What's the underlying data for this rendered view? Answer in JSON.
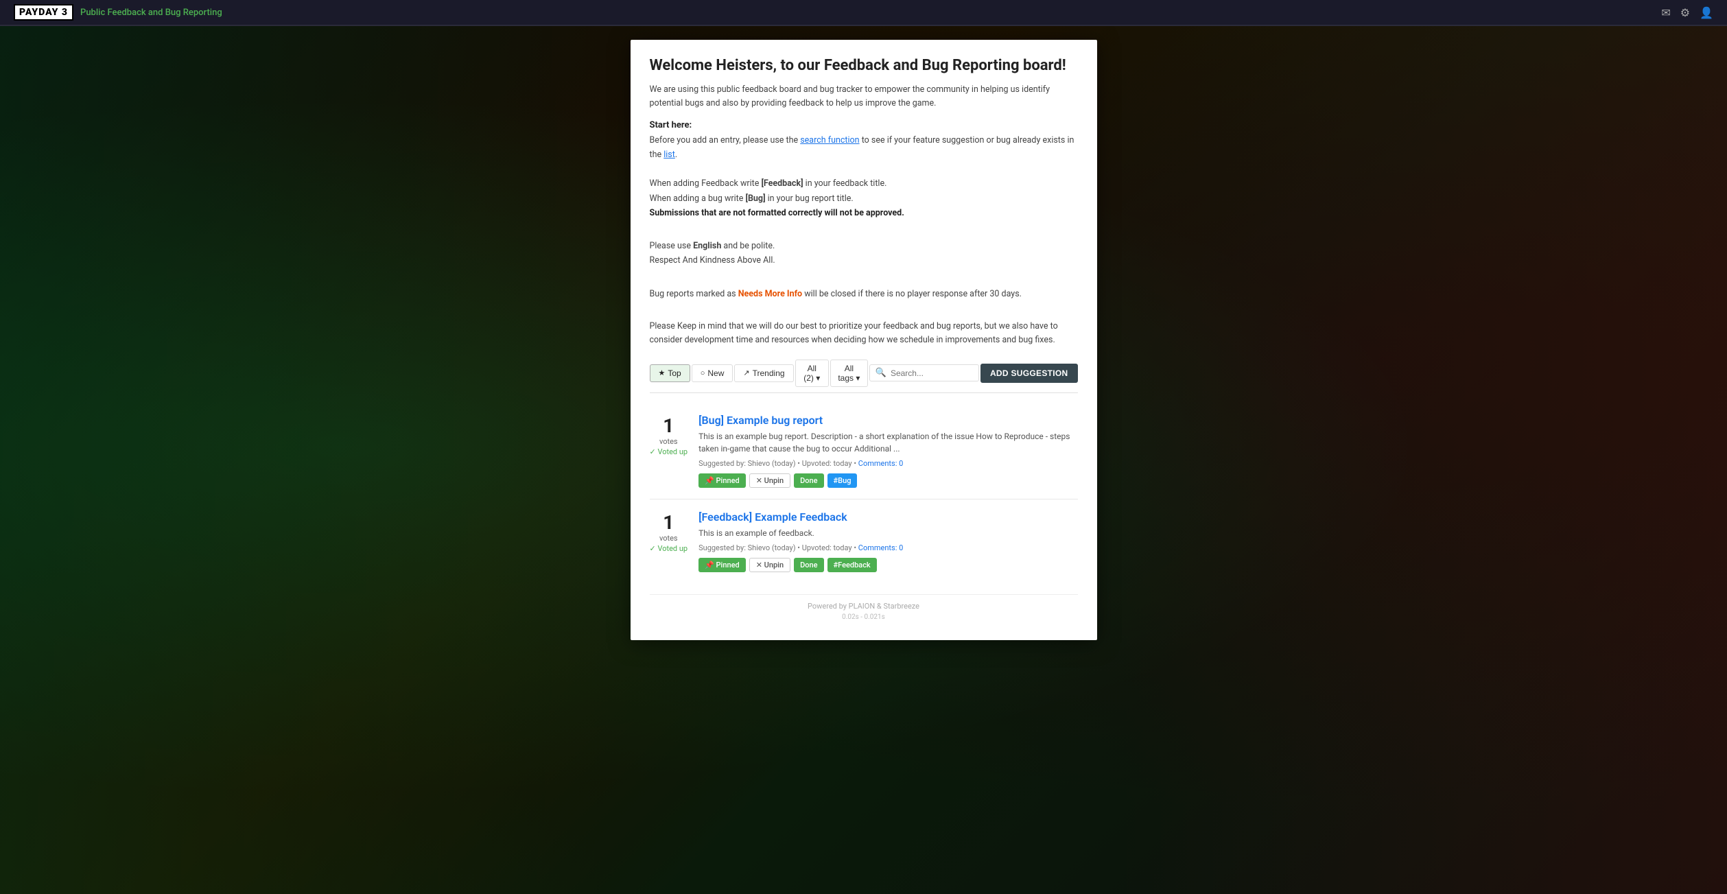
{
  "navbar": {
    "logo": "PAYDAY 3",
    "site_title": "Public Feedback and Bug Reporting",
    "icons": [
      "mail-icon",
      "settings-icon",
      "user-icon"
    ]
  },
  "welcome": {
    "title": "Welcome Heisters, to our Feedback and Bug Reporting board!",
    "description": "We are using this public feedback board and bug tracker to empower the community in helping us identify potential bugs and also by providing feedback to help us improve the game.",
    "start_here_label": "Start here:",
    "instruction_1": "Before you add an entry, please use the search function to see if your feature suggestion or bug already exists in the list.",
    "instruction_2a": "When adding Feedback write [Feedback] in your feedback title.",
    "instruction_2b": "When adding a bug write [Bug] in your bug report title.",
    "instruction_2c": "Submissions that are not formatted correctly will not be approved.",
    "lang_note_1": "Please use English and be polite.",
    "lang_note_2": "Respect And Kindness Above All.",
    "needs_more_info_note": "Bug reports marked as Needs More Info will be closed if there is no player response after 30 days.",
    "closing_note": "Please Keep in mind that we will do our best to prioritize your feedback and bug reports, but we also have to consider development time and resources when deciding how we schedule in improvements and bug fixes."
  },
  "filters": {
    "top_label": "Top",
    "new_label": "New",
    "trending_label": "Trending",
    "all_label": "All (2)",
    "all_tags_label": "All tags",
    "search_placeholder": "Search...",
    "add_button_label": "ADD SUGGESTION"
  },
  "posts": [
    {
      "id": "post-1",
      "vote_count": "1",
      "votes_label": "votes",
      "voted_up_label": "✓ Voted up",
      "title": "[Bug] Example bug report",
      "description": "This is an example bug report. Description - a short explanation of the issue How to Reproduce - steps taken in-game that cause the bug to occur Additional ...",
      "meta": "Suggested by: Shievo (today) • Upvoted: today • Comments: 0",
      "comments_label": "Comments: 0",
      "tags": [
        {
          "label": "📌 Pinned",
          "type": "pinned"
        },
        {
          "label": "✕ Unpin",
          "type": "unpin"
        },
        {
          "label": "Done",
          "type": "done"
        },
        {
          "label": "#Bug",
          "type": "bug"
        }
      ]
    },
    {
      "id": "post-2",
      "vote_count": "1",
      "votes_label": "votes",
      "voted_up_label": "✓ Voted up",
      "title": "[Feedback] Example Feedback",
      "description": "This is an example of feedback.",
      "meta": "Suggested by: Shievo (today) • Upvoted: today • Comments: 0",
      "comments_label": "Comments: 0",
      "tags": [
        {
          "label": "📌 Pinned",
          "type": "pinned"
        },
        {
          "label": "✕ Unpin",
          "type": "unpin"
        },
        {
          "label": "Done",
          "type": "done"
        },
        {
          "label": "#Feedback",
          "type": "feedback"
        }
      ]
    }
  ],
  "footer": {
    "powered_by": "Powered by PLAION & Starbreeze",
    "timing": "0.02s - 0.021s"
  }
}
